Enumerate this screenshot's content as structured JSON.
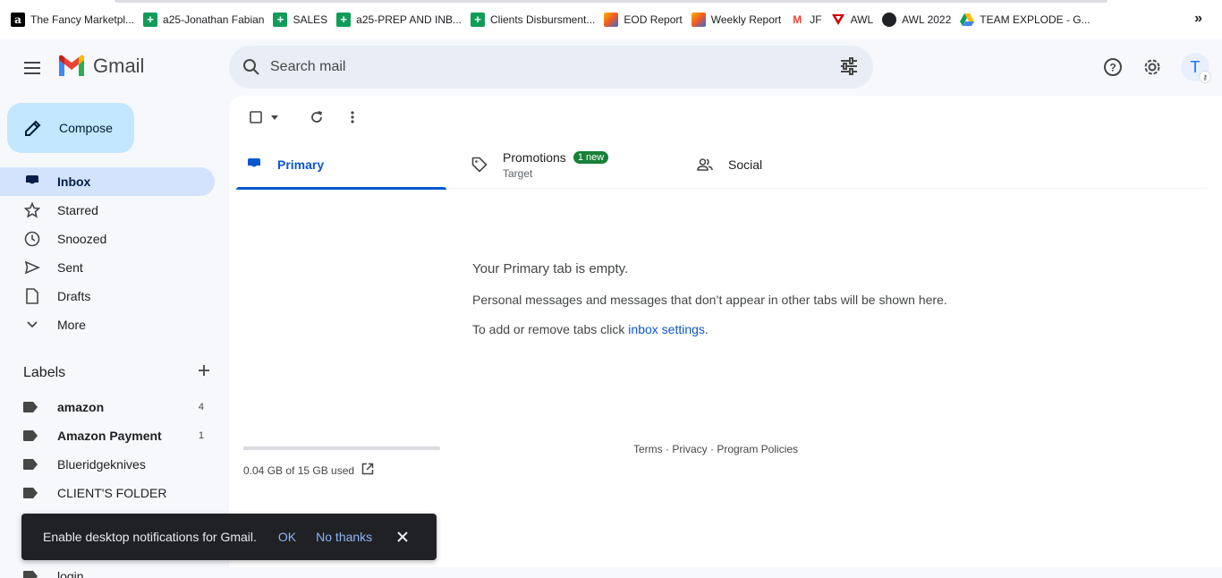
{
  "bookmarks": {
    "items": [
      {
        "label": "The Fancy Marketpl...",
        "icon": "amazon-icon"
      },
      {
        "label": "a25-Jonathan Fabian",
        "icon": "sheets-icon"
      },
      {
        "label": "SALES",
        "icon": "sheets-icon"
      },
      {
        "label": "a25-PREP AND INB...",
        "icon": "sheets-icon"
      },
      {
        "label": "Clients Disbursment...",
        "icon": "sheets-icon"
      },
      {
        "label": "EOD Report",
        "icon": "report-icon"
      },
      {
        "label": "Weekly Report",
        "icon": "report-icon"
      },
      {
        "label": "JF",
        "icon": "gmail-icon"
      },
      {
        "label": "AWL",
        "icon": "awl-icon"
      },
      {
        "label": "AWL 2022",
        "icon": "globe-icon"
      },
      {
        "label": "TEAM EXPLODE - G...",
        "icon": "drive-icon"
      }
    ],
    "more": "»"
  },
  "header": {
    "app_name": "Gmail",
    "search_placeholder": "Search mail",
    "avatar_initial": "T"
  },
  "sidebar": {
    "compose_label": "Compose",
    "items": [
      {
        "label": "Inbox",
        "icon": "inbox-icon",
        "active": true
      },
      {
        "label": "Starred",
        "icon": "star-icon"
      },
      {
        "label": "Snoozed",
        "icon": "clock-icon"
      },
      {
        "label": "Sent",
        "icon": "send-icon"
      },
      {
        "label": "Drafts",
        "icon": "draft-icon"
      },
      {
        "label": "More",
        "icon": "chevron-down-icon"
      }
    ],
    "labels_heading": "Labels",
    "labels": [
      {
        "label": "amazon",
        "count": "4",
        "bold": true
      },
      {
        "label": "Amazon Payment",
        "count": "1",
        "bold": true
      },
      {
        "label": "Blueridgeknives",
        "count": "",
        "bold": false
      },
      {
        "label": "CLIENT'S FOLDER",
        "count": "",
        "bold": false
      }
    ],
    "partial_label": "login"
  },
  "tabs": {
    "primary": "Primary",
    "promotions": "Promotions",
    "promotions_badge": "1 new",
    "promotions_sub": "Target",
    "social": "Social"
  },
  "empty_state": {
    "title": "Your Primary tab is empty.",
    "line1": "Personal messages and messages that don’t appear in other tabs will be shown here.",
    "line2_prefix": "To add or remove tabs click ",
    "line2_link": "inbox settings",
    "line2_suffix": "."
  },
  "storage": {
    "text": "0.04 GB of 15 GB used",
    "used_fraction": 0.0027
  },
  "footer": {
    "links": "Terms · Privacy · Program Policies"
  },
  "snackbar": {
    "message": "Enable desktop notifications for Gmail.",
    "ok": "OK",
    "no_thanks": "No thanks"
  },
  "colors": {
    "accent": "#0b57d0",
    "compose_bg": "#c2e7ff",
    "active_nav_bg": "#d3e3fd",
    "badge_green": "#188038",
    "snackbar_bg": "#202124"
  }
}
